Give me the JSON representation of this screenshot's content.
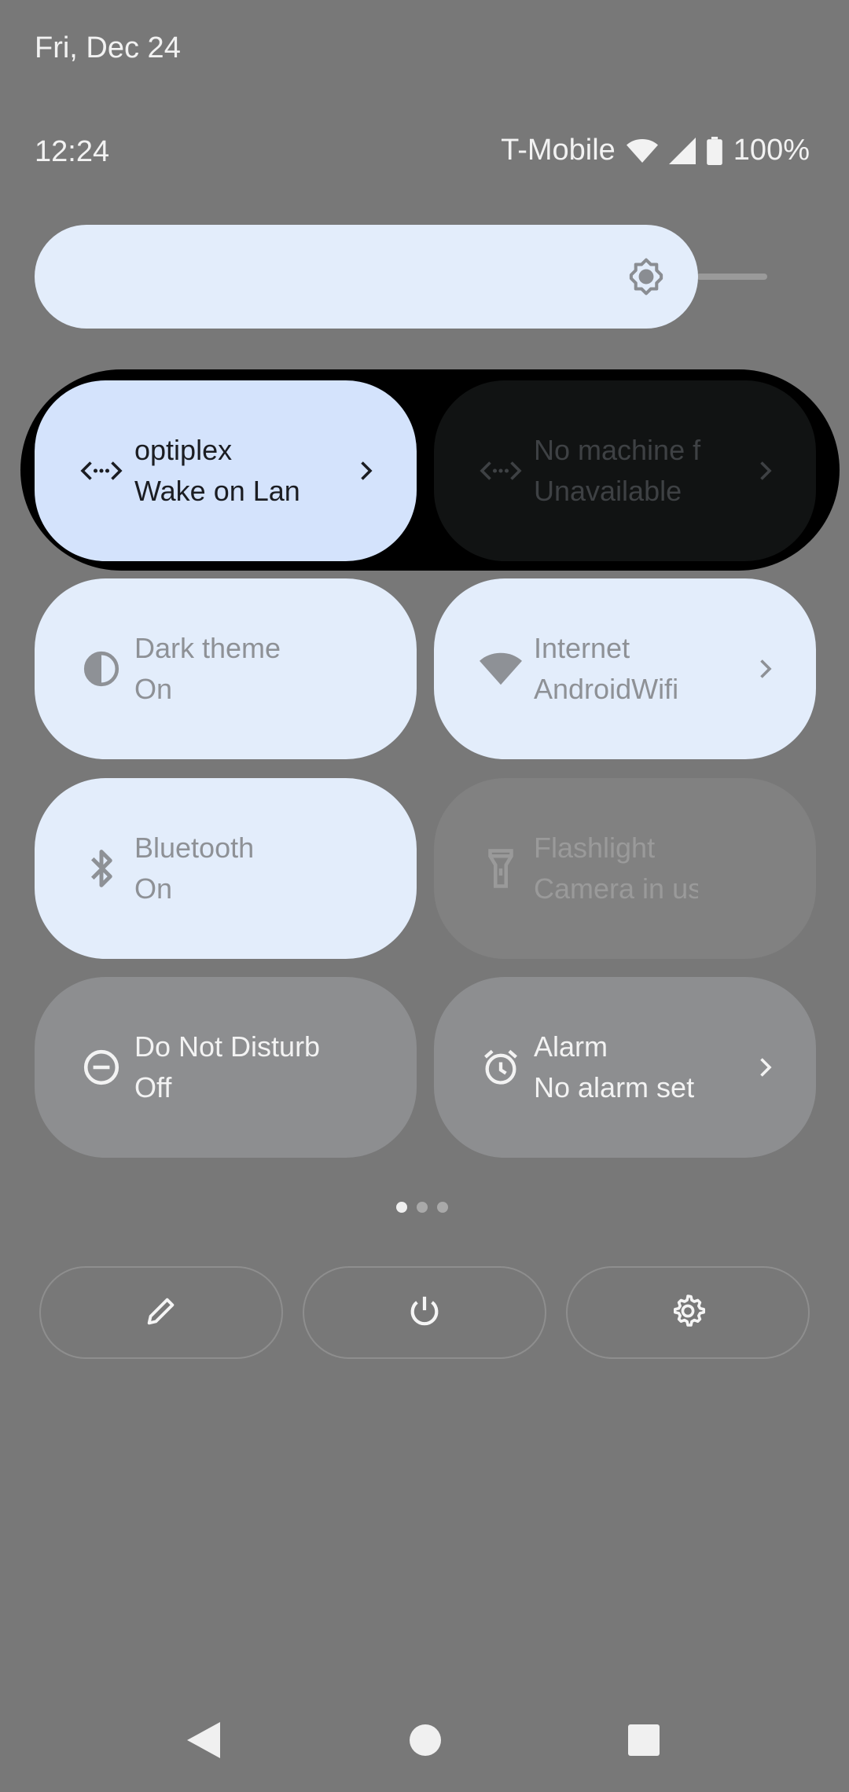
{
  "header": {
    "date": "Fri, Dec 24",
    "time": "12:24",
    "carrier": "T-Mobile",
    "battery": "100%",
    "icons": [
      "wifi-icon",
      "cell-signal-icon",
      "battery-icon"
    ]
  },
  "brightness": {
    "level": 0.9,
    "icon": "brightness-icon"
  },
  "tiles": [
    {
      "id": "optiplex",
      "label": "optiplex",
      "sub": "Wake on Lan",
      "icon": "wake-on-lan-icon",
      "state": "active",
      "has_chevron": true
    },
    {
      "id": "nomachine",
      "label": "No machine f",
      "sub": "Unavailable",
      "icon": "wake-on-lan-icon",
      "state": "unavailable",
      "has_chevron": true
    },
    {
      "id": "dark",
      "label": "Dark theme",
      "sub": "On",
      "icon": "dark-theme-icon",
      "state": "on",
      "has_chevron": false
    },
    {
      "id": "internet",
      "label": "Internet",
      "sub": "AndroidWifi",
      "icon": "wifi-icon",
      "state": "on",
      "has_chevron": true
    },
    {
      "id": "bluetooth",
      "label": "Bluetooth",
      "sub": "On",
      "icon": "bluetooth-icon",
      "state": "on",
      "has_chevron": false
    },
    {
      "id": "flash",
      "label": "Flashlight",
      "sub": "Camera in use",
      "icon": "flashlight-icon",
      "state": "disabled",
      "has_chevron": false
    },
    {
      "id": "dnd",
      "label": "Do Not Disturb",
      "sub": "Off",
      "icon": "do-not-disturb-icon",
      "state": "off",
      "has_chevron": false
    },
    {
      "id": "alarm",
      "label": "Alarm",
      "sub": "No alarm set",
      "icon": "alarm-icon",
      "state": "off",
      "has_chevron": true
    }
  ],
  "pager": {
    "count": 3,
    "active_index": 0
  },
  "footer": {
    "buttons": [
      "edit-icon",
      "power-icon",
      "settings-icon"
    ]
  },
  "navbar": {
    "buttons": [
      "back-icon",
      "home-icon",
      "recents-icon"
    ]
  },
  "colors": {
    "background": "#787878",
    "tile_active": "#d4e3fc",
    "tile_on": "#e3edfb",
    "tile_off": "#8d8e90"
  }
}
